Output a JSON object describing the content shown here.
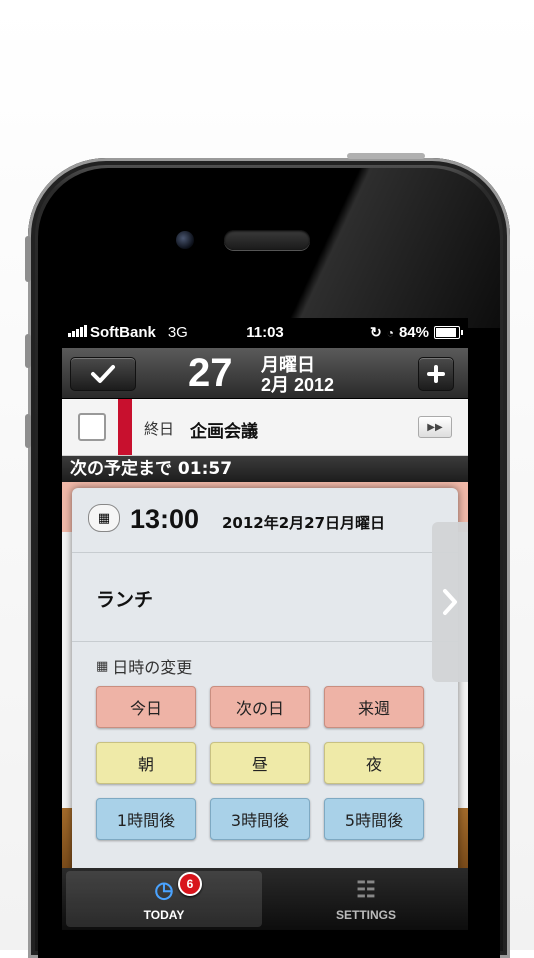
{
  "status_bar": {
    "carrier": "SoftBank",
    "network": "3G",
    "time": "11:03",
    "battery": "84%"
  },
  "navbar": {
    "day": "27",
    "weekday": "月曜日",
    "month_year": "2月 2012"
  },
  "event": {
    "allday_label": "終日",
    "title": "企画会議"
  },
  "countdown": "次の予定まで 01:57",
  "popup": {
    "time": "13:00",
    "date": "2012年2月27日月曜日",
    "title": "ランチ",
    "section_label": "日時の変更",
    "buttons": [
      {
        "label": "今日",
        "color": "pink"
      },
      {
        "label": "次の日",
        "color": "pink"
      },
      {
        "label": "来週",
        "color": "pink"
      },
      {
        "label": "朝",
        "color": "yellow"
      },
      {
        "label": "昼",
        "color": "yellow"
      },
      {
        "label": "夜",
        "color": "yellow"
      },
      {
        "label": "1時間後",
        "color": "blue"
      },
      {
        "label": "3時間後",
        "color": "blue"
      },
      {
        "label": "5時間後",
        "color": "blue"
      }
    ]
  },
  "tabbar": {
    "today_label": "TODAY",
    "today_badge": "6",
    "settings_label": "SETTINGS"
  },
  "colors": {
    "accent_red": "#c8102e",
    "pink": "#eeb3a6",
    "yellow": "#efeaa8",
    "blue": "#a9d1e8"
  }
}
